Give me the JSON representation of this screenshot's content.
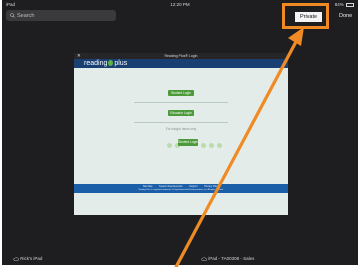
{
  "status_bar": {
    "left": "iPad",
    "time": "12:20 PM",
    "battery": "84%"
  },
  "toolbar": {
    "search_placeholder": "Search",
    "private_label": "Private",
    "done_label": "Done"
  },
  "tab": {
    "title": "Reading Plus® Login",
    "logo_left": "reading",
    "logo_right": "plus",
    "buttons": {
      "first": "Student Login",
      "second": "Educator Login",
      "third": "Student Login"
    },
    "divider_text": "For Insight users only",
    "footer_links": [
      "Site Map",
      "System Requirements",
      "Support",
      "Privacy Policy"
    ],
    "footer_copy": "Reading Plus is a registered trademark of Taylor Associates/Communications, Inc. All rights reserved."
  },
  "bottom_bar": {
    "left_device": "Rick's iPad",
    "center_device": "iPad - TA00308 - Sales"
  },
  "colors": {
    "highlight": "#f08a24",
    "brand_blue": "#1a3f72",
    "button_green": "#4d9a3a"
  }
}
